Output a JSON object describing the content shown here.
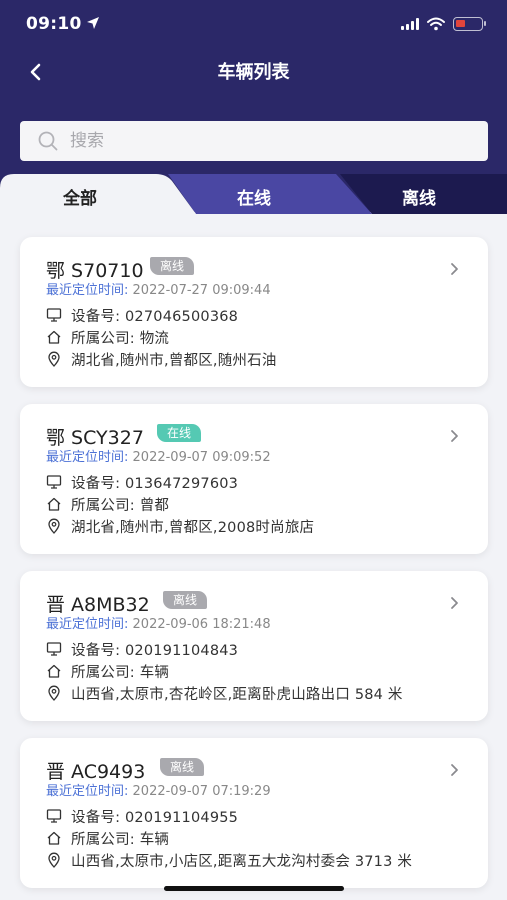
{
  "status_bar": {
    "time": "09:10"
  },
  "header": {
    "title": "车辆列表"
  },
  "search": {
    "placeholder": "搜索"
  },
  "tabs": [
    {
      "label": "全部",
      "active": true
    },
    {
      "label": "在线",
      "active": false
    },
    {
      "label": "离线",
      "active": false
    }
  ],
  "colors": {
    "header_bg": "#2b2868",
    "tab_online_bg": "#4a47a3",
    "tab_offline_bg": "#1c1a4f",
    "online_badge": "#55c9b3",
    "offline_badge": "#a9a9ae",
    "time_label": "#4d72d6"
  },
  "vehicles": [
    {
      "plate": "鄂 S70710",
      "status": "离线",
      "time_label": "最近定位时间:",
      "time": "2022-07-27 09:09:44",
      "device": "设备号: 027046500368",
      "company": "所属公司: 物流",
      "location": "湖北省,随州市,曾都区,随州石油"
    },
    {
      "plate": "鄂 SCY327",
      "status": "在线",
      "time_label": "最近定位时间:",
      "time": "2022-09-07 09:09:52",
      "device": "设备号: 013647297603",
      "company": "所属公司: 曾都",
      "location": "湖北省,随州市,曾都区,2008时尚旅店"
    },
    {
      "plate": "晋 A8MB32",
      "status": "离线",
      "time_label": "最近定位时间:",
      "time": "2022-09-06 18:21:48",
      "device": "设备号: 020191104843",
      "company": "所属公司: 车辆",
      "location": "山西省,太原市,杏花岭区,距离卧虎山路出口 584 米"
    },
    {
      "plate": "晋 AC9493",
      "status": "离线",
      "time_label": "最近定位时间:",
      "time": "2022-09-07 07:19:29",
      "device": "设备号: 020191104955",
      "company": "所属公司: 车辆",
      "location": "山西省,太原市,小店区,距离五大龙沟村委会 3713 米"
    }
  ]
}
